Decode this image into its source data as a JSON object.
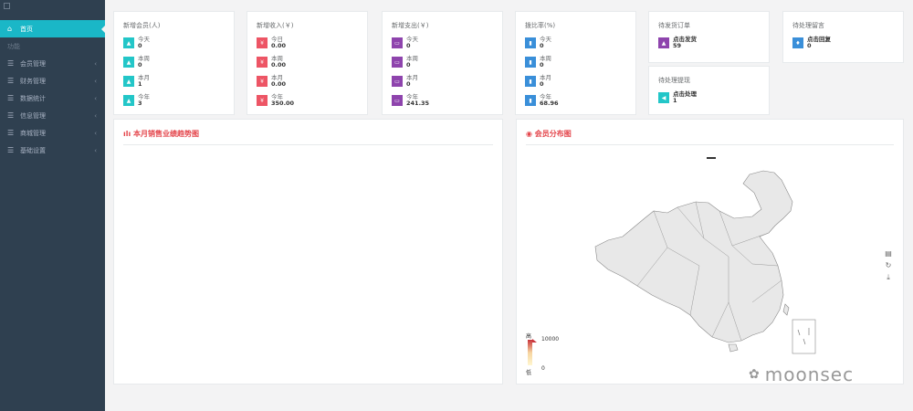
{
  "sidebar": {
    "home": "首页",
    "section": "功能",
    "items": [
      {
        "label": "会员管理",
        "icon": "list-icon"
      },
      {
        "label": "财务管理",
        "icon": "list-icon"
      },
      {
        "label": "数据统计",
        "icon": "list-icon"
      },
      {
        "label": "信息管理",
        "icon": "list-icon"
      },
      {
        "label": "商城管理",
        "icon": "list-icon"
      },
      {
        "label": "基础设置",
        "icon": "list-icon"
      }
    ]
  },
  "stats": [
    {
      "title": "新增会员(人)",
      "color": "#23c6c8",
      "icon": "user-icon",
      "rows": [
        {
          "label": "今天",
          "value": "0"
        },
        {
          "label": "本周",
          "value": "0"
        },
        {
          "label": "本月",
          "value": "1"
        },
        {
          "label": "今年",
          "value": "3"
        }
      ]
    },
    {
      "title": "新增收入(￥)",
      "color": "#ed5565",
      "icon": "yen-icon",
      "rows": [
        {
          "label": "今日",
          "value": "0.00"
        },
        {
          "label": "本周",
          "value": "0.00"
        },
        {
          "label": "本月",
          "value": "0.00"
        },
        {
          "label": "今年",
          "value": "350.00"
        }
      ]
    },
    {
      "title": "新增支出(￥)",
      "color": "#8e44ad",
      "icon": "card-icon",
      "rows": [
        {
          "label": "今天",
          "value": "0"
        },
        {
          "label": "本周",
          "value": "0"
        },
        {
          "label": "本月",
          "value": "0"
        },
        {
          "label": "今年",
          "value": "241.35"
        }
      ]
    },
    {
      "title": "拨比率(%)",
      "color": "#3a8fd9",
      "icon": "bar-icon",
      "rows": [
        {
          "label": "今天",
          "value": "0"
        },
        {
          "label": "本周",
          "value": "0"
        },
        {
          "label": "本月",
          "value": "0"
        },
        {
          "label": "今年",
          "value": "68.96"
        }
      ]
    }
  ],
  "pending_orders": {
    "title": "待发货订单",
    "action": "点击发货",
    "count": "59",
    "color": "#8e44ad"
  },
  "pending_withdraw": {
    "title": "待处理提现",
    "action": "点击处理",
    "count": "1",
    "color": "#23c6c8"
  },
  "pending_messages": {
    "title": "待处理留言",
    "action": "点击回复",
    "count": "0",
    "color": "#3a8fd9"
  },
  "sales_panel": {
    "title": "本月销售业绩趋势图"
  },
  "map_panel": {
    "title": "会员分布图",
    "legend_high_label": "高",
    "legend_low_label": "低",
    "legend_max": "10000",
    "legend_min": "0"
  },
  "watermark": "moonsec"
}
